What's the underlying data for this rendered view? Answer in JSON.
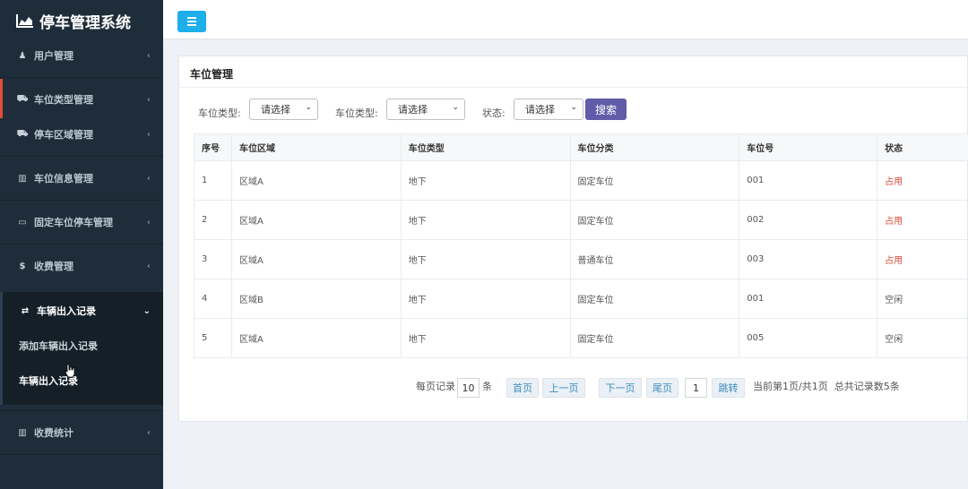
{
  "app": {
    "title": "停车管理系统"
  },
  "sidebar": {
    "items": [
      {
        "label": "用户管理",
        "icon": "user-icon"
      },
      {
        "label": "车位类型管理",
        "icon": "car-icon"
      },
      {
        "label": "停车区域管理",
        "icon": "car-icon"
      },
      {
        "label": "车位信息管理",
        "icon": "map-icon"
      },
      {
        "label": "固定车位停车管理",
        "icon": "credit-card-icon"
      },
      {
        "label": "收费管理",
        "icon": "dollar-icon"
      },
      {
        "label": "车辆出入记录",
        "icon": "exchange-icon"
      },
      {
        "label": "收费统计",
        "icon": "bar-chart-icon"
      }
    ],
    "sub_items": [
      {
        "label": "添加车辆出入记录"
      },
      {
        "label": "车辆出入记录"
      }
    ]
  },
  "panel": {
    "title": "车位管理"
  },
  "filters": {
    "type1_label": "车位类型:",
    "type1_value": "请选择",
    "type2_label": "车位类型:",
    "type2_value": "请选择",
    "status_label": "状态:",
    "status_value": "请选择",
    "search_label": "搜索"
  },
  "table": {
    "headers": [
      "序号",
      "车位区域",
      "车位类型",
      "车位分类",
      "车位号",
      "状态"
    ],
    "rows": [
      [
        "1",
        "区域A",
        "地下",
        "固定车位",
        "001",
        "占用"
      ],
      [
        "2",
        "区域A",
        "地下",
        "固定车位",
        "002",
        "占用"
      ],
      [
        "3",
        "区域A",
        "地下",
        "普通车位",
        "003",
        "占用"
      ],
      [
        "4",
        "区域B",
        "地下",
        "固定车位",
        "001",
        "空闲"
      ],
      [
        "5",
        "区域A",
        "地下",
        "固定车位",
        "005",
        "空闲"
      ]
    ]
  },
  "pagination": {
    "per_page_label": "每页记录",
    "per_page_value": "10",
    "per_page_unit": "条",
    "first": "首页",
    "prev": "上一页",
    "next": "下一页",
    "last": "尾页",
    "page_value": "1",
    "jump": "跳转",
    "info": "当前第1页/共1页  总共记录数5条"
  },
  "colors": {
    "sidebar_bg": "#1f2d3a",
    "toggle": "#1eaeea",
    "search": "#605ca8",
    "occupied": "#dd4b39",
    "active_marker": "#dd4b39"
  }
}
